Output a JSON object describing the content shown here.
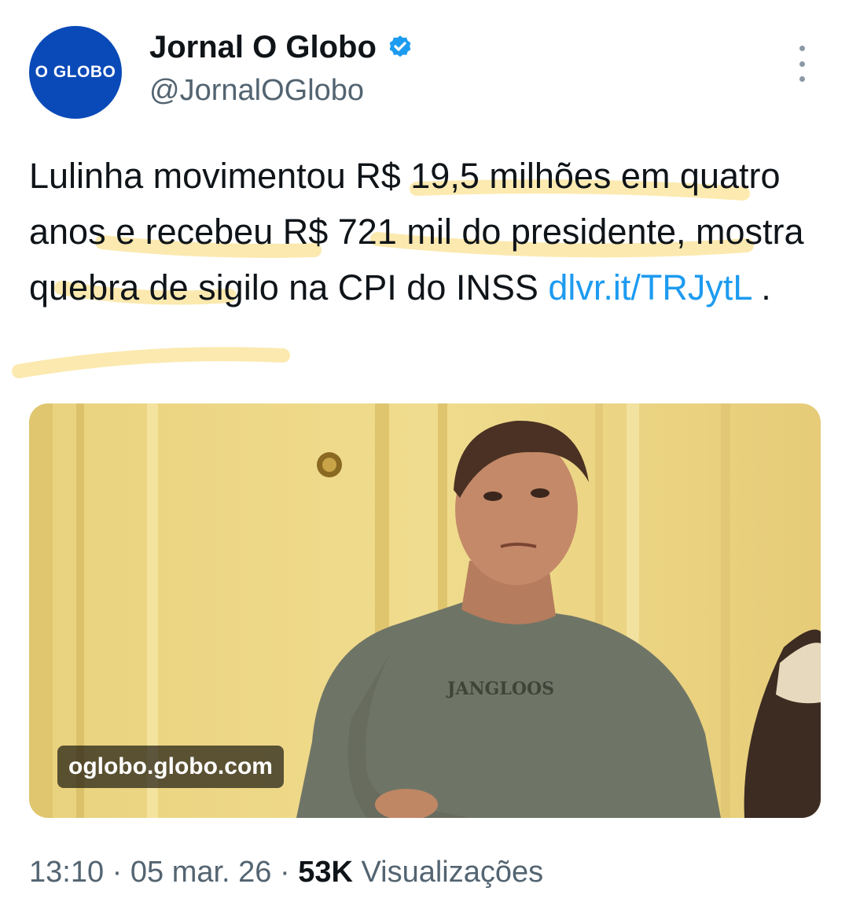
{
  "author": {
    "avatar_text": "O GLOBO",
    "display_name": "Jornal O Globo",
    "handle": "@JornalOGlobo",
    "verified_icon": "verified-badge-icon",
    "brand_color": "#0a4ab8"
  },
  "more_icon": "more-options-icon",
  "tweet": {
    "text_part1": "Lulinha movimentou R$ 19,5 milhões em quatro anos e recebeu R$ 721 mil do presidente, mostra quebra de sigilo na CPI do INSS ",
    "link": "dlvr.it/TRJytL",
    "text_part2": " .",
    "link_color": "#1d9bf0",
    "highlight_color": "#fbe6a2"
  },
  "media": {
    "source_label": "oglobo.globo.com",
    "shirt_text": "JANGLOOS"
  },
  "meta": {
    "time": "13:10",
    "sep1": " · ",
    "date": "05 mar. 26",
    "sep2": " · ",
    "views_count": "53K",
    "views_label": " Visualizações"
  }
}
